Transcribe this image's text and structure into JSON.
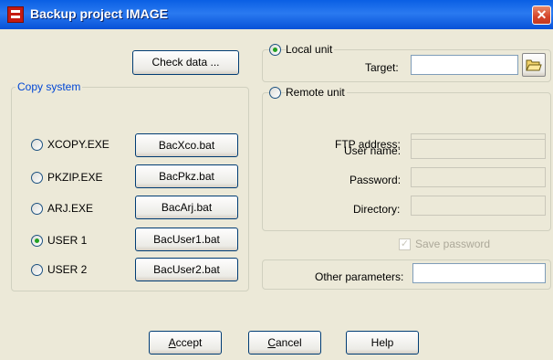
{
  "window": {
    "title": "Backup project IMAGE",
    "close_glyph": "✕"
  },
  "check_data_label": "Check data ...",
  "copy_system": {
    "legend": "Copy system",
    "options": [
      {
        "label": "XCOPY.EXE",
        "bat": "BacXco.bat",
        "selected": false
      },
      {
        "label": "PKZIP.EXE",
        "bat": "BacPkz.bat",
        "selected": false
      },
      {
        "label": "ARJ.EXE",
        "bat": "BacArj.bat",
        "selected": false
      },
      {
        "label": "USER 1",
        "bat": "BacUser1.bat",
        "selected": true
      },
      {
        "label": "USER 2",
        "bat": "BacUser2.bat",
        "selected": false
      }
    ]
  },
  "local_unit": {
    "label": "Local unit",
    "selected": true,
    "target_label": "Target:",
    "target_value": "",
    "browse_icon": "folder-open-icon"
  },
  "remote_unit": {
    "label": "Remote unit",
    "selected": false,
    "ftp_label": "FTP address:",
    "ftp_value": "",
    "user_label": "User name:",
    "user_value": "",
    "password_label": "Password:",
    "password_value": "",
    "directory_label": "Directory:",
    "directory_value": ""
  },
  "save_password": {
    "label": "Save password",
    "checked": true,
    "enabled": false
  },
  "other_parameters": {
    "label": "Other parameters:",
    "value": ""
  },
  "footer": {
    "accept_mnemonic": "A",
    "accept_rest": "ccept",
    "cancel_mnemonic": "C",
    "cancel_rest": "ancel",
    "help": "Help"
  }
}
